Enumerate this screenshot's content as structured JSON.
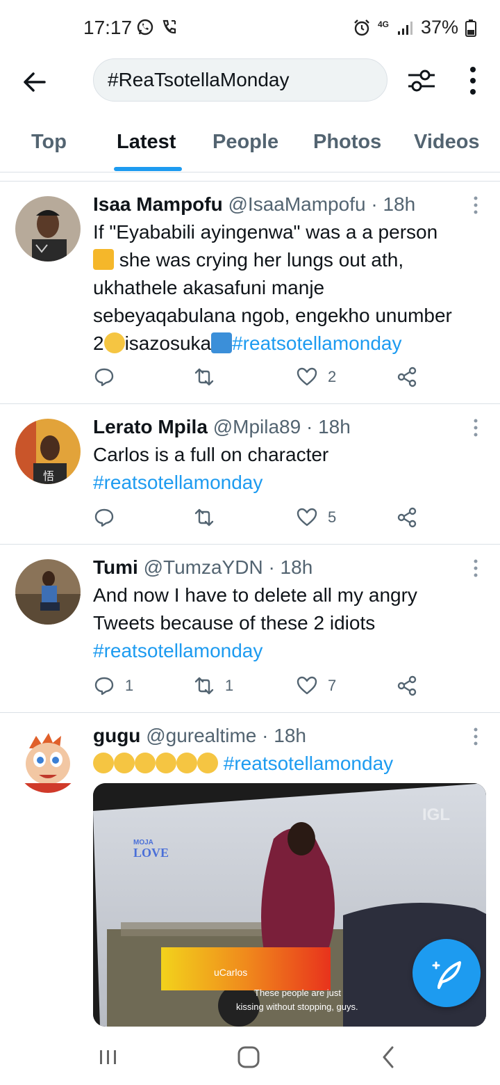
{
  "status_bar": {
    "time": "17:17",
    "battery": "37%",
    "network": "4G"
  },
  "search": {
    "query": "#ReaTsotellaMonday"
  },
  "tabs": [
    {
      "label": "Top",
      "active": false
    },
    {
      "label": "Latest",
      "active": true
    },
    {
      "label": "People",
      "active": false
    },
    {
      "label": "Photos",
      "active": false
    },
    {
      "label": "Videos",
      "active": false
    }
  ],
  "tweets": [
    {
      "name": "Isaa Mampofu",
      "handle": "@IsaaMampofu",
      "time": "· 18h",
      "text_lines": [
        "If  \"Eyababili ayingenwa\" was a a person",
        "she was crying her lungs out ath,",
        "ukhathele akasafuni manje",
        "sebeyaqabulana ngob, engekho unumber",
        "2",
        "isazosuka"
      ],
      "hashtag": "#reatsotellamonday",
      "replies": "",
      "retweets": "",
      "likes": "2"
    },
    {
      "name": "Lerato Mpila",
      "handle": "@Mpila89",
      "time": "· 18h",
      "text_lines": [
        "Carlos is a full on character"
      ],
      "hashtag": "#reatsotellamonday",
      "replies": "",
      "retweets": "",
      "likes": "5"
    },
    {
      "name": "Tumi",
      "handle": "@TumzaYDN",
      "time": "· 18h",
      "text_lines": [
        "And now I have to delete all my angry",
        "Tweets because of these 2 idiots"
      ],
      "hashtag": "#reatsotellamonday",
      "replies": "1",
      "retweets": "1",
      "likes": "7"
    },
    {
      "name": "gugu",
      "handle": "@gurealtime",
      "time": "· 18h",
      "hashtag": "#reatsotellamonday",
      "media": {
        "channel_top": "MOJA",
        "channel_bottom": "LOVE",
        "watermark": "IGL",
        "banner_name": "uCarlos",
        "subtitle_line1": "These people are just",
        "subtitle_line2": "kissing without stopping, guys."
      }
    }
  ],
  "colors": {
    "accent": "#1d9bf0",
    "text": "#0f1419",
    "secondary": "#536471"
  }
}
